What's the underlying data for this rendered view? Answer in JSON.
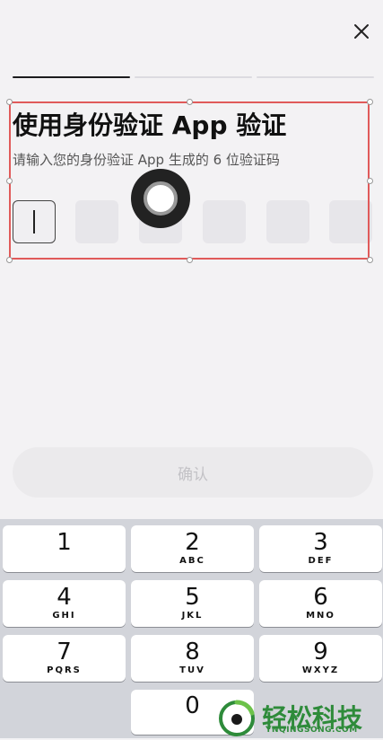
{
  "header": {
    "close_icon": "close-icon"
  },
  "progress": {
    "steps": 3,
    "current": 1
  },
  "verify": {
    "title": "使用身份验证 App 验证",
    "subtitle": "请输入您的身份验证 App 生成的 6 位验证码",
    "code_length": 6
  },
  "confirm_button": {
    "label": "确认"
  },
  "keyboard": {
    "keys": [
      {
        "digit": "1",
        "letters": ""
      },
      {
        "digit": "2",
        "letters": "ABC"
      },
      {
        "digit": "3",
        "letters": "DEF"
      },
      {
        "digit": "4",
        "letters": "GHI"
      },
      {
        "digit": "5",
        "letters": "JKL"
      },
      {
        "digit": "6",
        "letters": "MNO"
      },
      {
        "digit": "7",
        "letters": "PQRS"
      },
      {
        "digit": "8",
        "letters": "TUV"
      },
      {
        "digit": "9",
        "letters": "WXYZ"
      },
      {
        "digit": "0",
        "letters": ""
      }
    ]
  },
  "watermark": {
    "text": "轻松科技",
    "sub": "YNQINGSONG.COM",
    "color": "#2e8b3a"
  }
}
